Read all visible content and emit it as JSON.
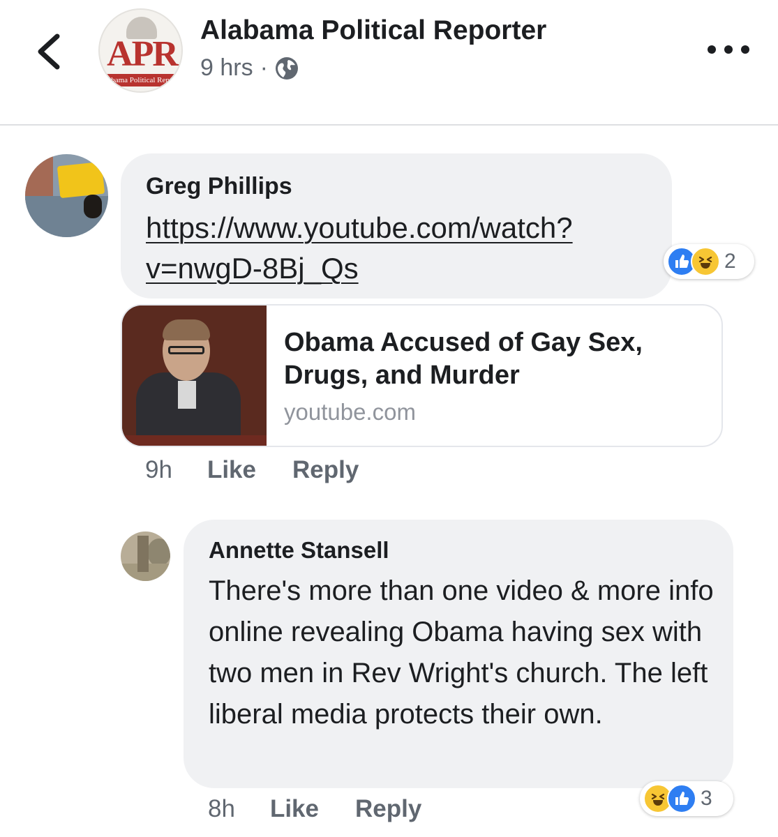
{
  "header": {
    "page_name": "Alabama Political Reporter",
    "avatar_logo_text": "APR",
    "avatar_logo_subtext": "Alabama Political Reporter",
    "post_time": "9 hrs",
    "separator": "·",
    "privacy_icon": "globe-icon",
    "back_icon": "chevron-left-icon",
    "more_icon": "more-horizontal-icon"
  },
  "comments": [
    {
      "author": "Greg Phillips",
      "link_text": "https://www.youtube.com/watch?v=nwgD-8Bj_Qs",
      "preview": {
        "title": "Obama Accused of Gay Sex, Drugs, and Murder",
        "domain": "youtube.com"
      },
      "reactions": {
        "icons": [
          "like-icon",
          "haha-icon"
        ],
        "count": "2"
      },
      "time": "9h",
      "like_label": "Like",
      "reply_label": "Reply"
    },
    {
      "author": "Annette Stansell",
      "text": "There's more than one video & more info online revealing Obama having sex with two men in Rev Wright's church. The left liberal media protects their own.",
      "reactions": {
        "icons": [
          "haha-icon",
          "like-icon"
        ],
        "count": "3"
      },
      "time": "8h",
      "like_label": "Like",
      "reply_label": "Reply"
    }
  ],
  "colors": {
    "like_blue": "#2e7ef2",
    "haha_yellow": "#f7c634",
    "bubble_bg": "#f0f1f3",
    "secondary_text": "#606770"
  }
}
